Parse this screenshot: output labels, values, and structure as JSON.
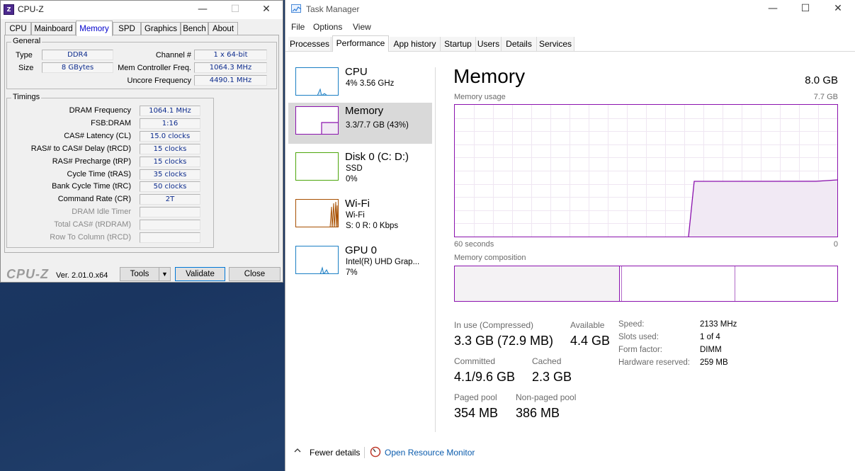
{
  "cpuz": {
    "title": "CPU-Z",
    "tabs": [
      "CPU",
      "Mainboard",
      "Memory",
      "SPD",
      "Graphics",
      "Bench",
      "About"
    ],
    "active_tab": "Memory",
    "general": {
      "label": "General",
      "type_label": "Type",
      "type_value": "DDR4",
      "size_label": "Size",
      "size_value": "8 GBytes",
      "channel_label": "Channel #",
      "channel_value": "1 x 64-bit",
      "mem_ctrl_label": "Mem Controller Freq.",
      "mem_ctrl_value": "1064.3 MHz",
      "uncore_label": "Uncore Frequency",
      "uncore_value": "4490.1 MHz"
    },
    "timings": {
      "label": "Timings",
      "rows": [
        {
          "label": "DRAM Frequency",
          "value": "1064.1 MHz",
          "disabled": false
        },
        {
          "label": "FSB:DRAM",
          "value": "1:16",
          "disabled": false
        },
        {
          "label": "CAS# Latency (CL)",
          "value": "15.0 clocks",
          "disabled": false
        },
        {
          "label": "RAS# to CAS# Delay (tRCD)",
          "value": "15 clocks",
          "disabled": false
        },
        {
          "label": "RAS# Precharge (tRP)",
          "value": "15 clocks",
          "disabled": false
        },
        {
          "label": "Cycle Time (tRAS)",
          "value": "35 clocks",
          "disabled": false
        },
        {
          "label": "Bank Cycle Time (tRC)",
          "value": "50 clocks",
          "disabled": false
        },
        {
          "label": "Command Rate (CR)",
          "value": "2T",
          "disabled": false
        },
        {
          "label": "DRAM Idle Timer",
          "value": "",
          "disabled": true
        },
        {
          "label": "Total CAS# (tRDRAM)",
          "value": "",
          "disabled": true
        },
        {
          "label": "Row To Column (tRCD)",
          "value": "",
          "disabled": true
        }
      ]
    },
    "brand": "CPU-Z",
    "version": "Ver. 2.01.0.x64",
    "tools_label": "Tools",
    "validate_label": "Validate",
    "close_label": "Close"
  },
  "taskmgr": {
    "title": "Task Manager",
    "menu": [
      "File",
      "Options",
      "View"
    ],
    "tabs": [
      "Processes",
      "Performance",
      "App history",
      "Startup",
      "Users",
      "Details",
      "Services"
    ],
    "active_tab": "Performance",
    "sidebar": [
      {
        "name": "CPU",
        "line1": "4% 3.56 GHz",
        "line2": "",
        "line3": "",
        "color": "#1b7fc4"
      },
      {
        "name": "Memory",
        "line1": "3.3/7.7 GB (43%)",
        "line2": "",
        "line3": "",
        "color": "#8b12ae"
      },
      {
        "name": "Disk 0 (C: D:)",
        "line1": "SSD",
        "line2": "0%",
        "line3": "",
        "color": "#4da60c"
      },
      {
        "name": "Wi-Fi",
        "line1": "Wi-Fi",
        "line2": "S: 0 R: 0 Kbps",
        "line3": "",
        "color": "#a74f01"
      },
      {
        "name": "GPU 0",
        "line1": "Intel(R) UHD Grap...",
        "line2": "7%",
        "line3": "",
        "color": "#1b7fc4"
      }
    ],
    "memory": {
      "heading": "Memory",
      "total": "8.0 GB",
      "usage_label": "Memory usage",
      "usage_max": "7.7 GB",
      "time_left": "60 seconds",
      "time_right": "0",
      "composition_label": "Memory composition",
      "usage_fraction": 0.43,
      "stats": {
        "in_use_label": "In use (Compressed)",
        "in_use_value": "3.3 GB (72.9 MB)",
        "available_label": "Available",
        "available_value": "4.4 GB",
        "committed_label": "Committed",
        "committed_value": "4.1/9.6 GB",
        "cached_label": "Cached",
        "cached_value": "2.3 GB",
        "paged_label": "Paged pool",
        "paged_value": "354 MB",
        "nonpaged_label": "Non-paged pool",
        "nonpaged_value": "386 MB"
      },
      "specs": [
        {
          "label": "Speed:",
          "value": "2133 MHz"
        },
        {
          "label": "Slots used:",
          "value": "1 of 4"
        },
        {
          "label": "Form factor:",
          "value": "DIMM"
        },
        {
          "label": "Hardware reserved:",
          "value": "259 MB"
        }
      ]
    },
    "footer": {
      "fewer_details": "Fewer details",
      "open_monitor": "Open Resource Monitor"
    }
  }
}
